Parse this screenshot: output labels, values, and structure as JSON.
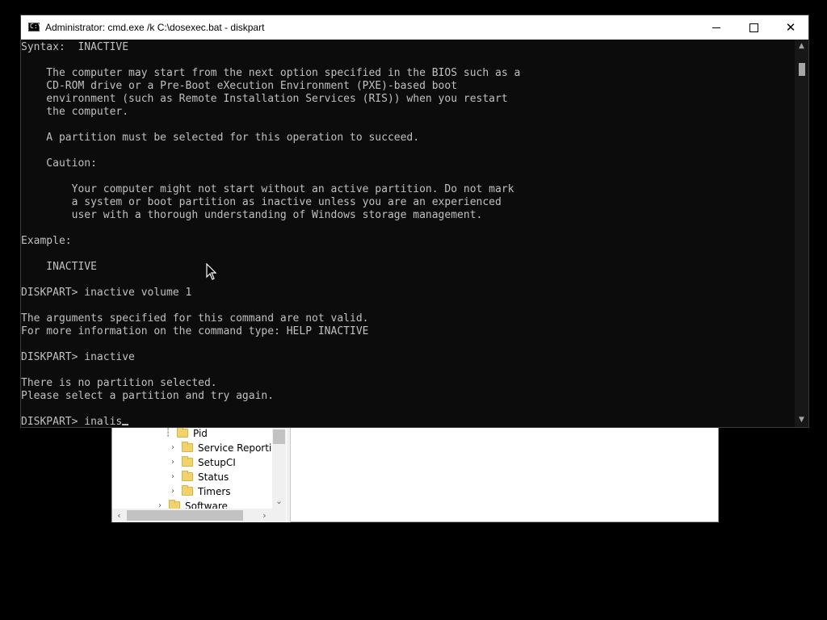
{
  "console": {
    "title": "Administrator: cmd.exe /k C:\\dosexec.bat - diskpart",
    "icon_label": "C:\\",
    "buttons": {
      "minimize": "minimize-icon",
      "maximize": "maximize-icon",
      "close": "close-icon"
    },
    "lines": [
      "Syntax:  INACTIVE",
      "",
      "    The computer may start from the next option specified in the BIOS such as a",
      "    CD-ROM drive or a Pre-Boot eXecution Environment (PXE)-based boot",
      "    environment (such as Remote Installation Services (RIS)) when you restart",
      "    the computer.",
      "",
      "    A partition must be selected for this operation to succeed.",
      "",
      "    Caution:",
      "",
      "        Your computer might not start without an active partition. Do not mark",
      "        a system or boot partition as inactive unless you are an experienced",
      "        user with a thorough understanding of Windows storage management.",
      "",
      "Example:",
      "",
      "    INACTIVE",
      "",
      "DISKPART> inactive volume 1",
      "",
      "The arguments specified for this command are not valid.",
      "For more information on the command type: HELP INACTIVE",
      "",
      "DISKPART> inactive",
      "",
      "There is no partition selected.",
      "Please select a partition and try again.",
      ""
    ],
    "prompt_line": "DISKPART> inalis",
    "colors": {
      "background": "#0c0c0c",
      "text": "#c0c0c0"
    }
  },
  "registry": {
    "tree_items": [
      {
        "label": "Pid",
        "icon": "folder-icon",
        "chevron": ""
      },
      {
        "label": "Service Reporting",
        "icon": "folder-icon",
        "chevron": "›"
      },
      {
        "label": "SetupCI",
        "icon": "folder-icon",
        "chevron": "›"
      },
      {
        "label": "Status",
        "icon": "folder-icon",
        "chevron": "›"
      },
      {
        "label": "Timers",
        "icon": "folder-icon",
        "chevron": "›"
      },
      {
        "label": "Software",
        "icon": "folder-icon",
        "chevron": "›"
      }
    ],
    "scroll_icons": {
      "left": "‹",
      "right": "›",
      "down": "⌄"
    }
  }
}
